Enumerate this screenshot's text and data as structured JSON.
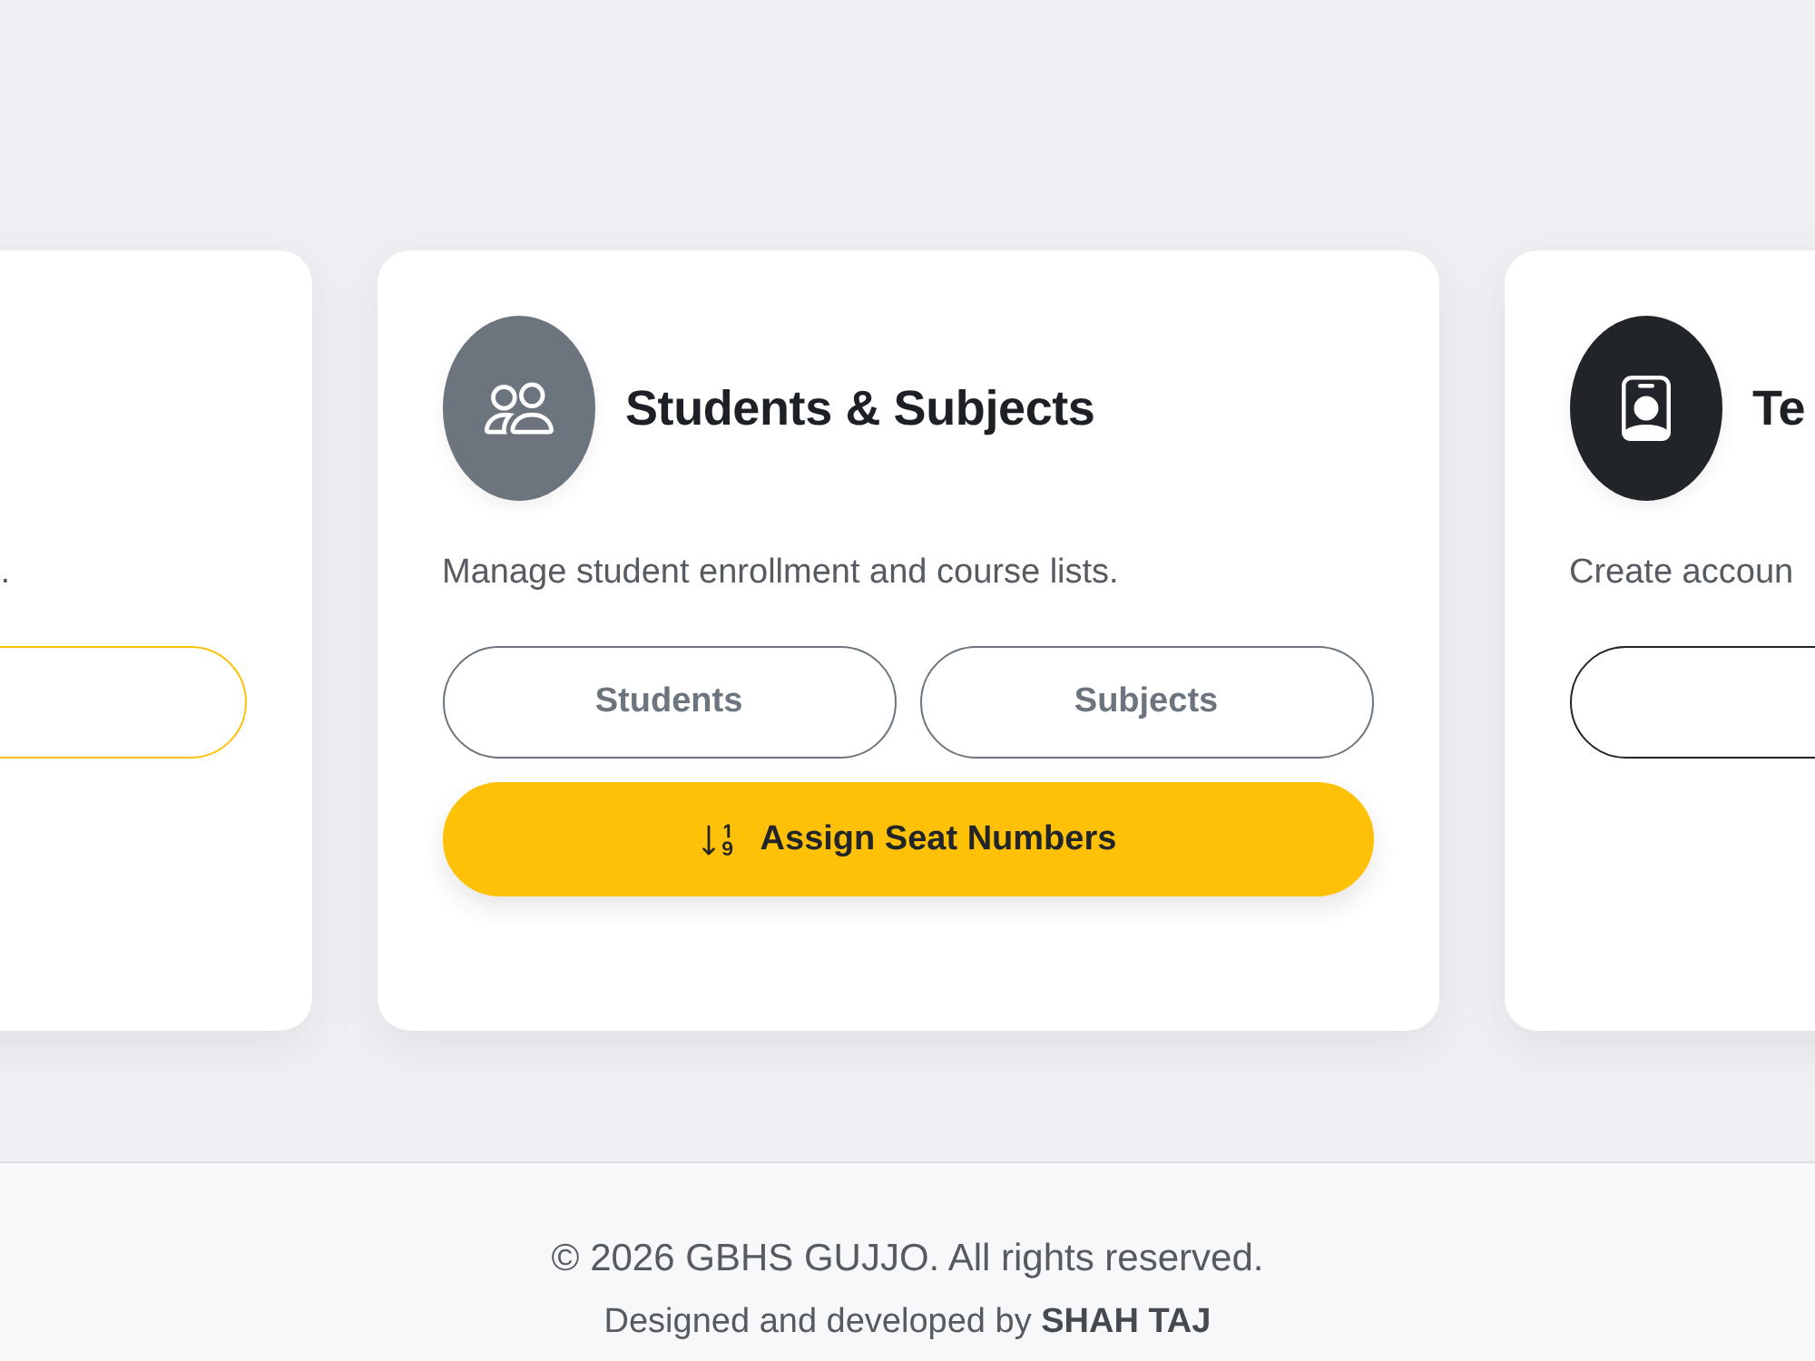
{
  "cards": [
    {
      "description": ".",
      "button_rows": [
        [
          {
            "kind": "outline",
            "color": "#ffc107"
          }
        ]
      ]
    },
    {
      "color": "#6c757d",
      "title": "Students & Subjects",
      "description": "Manage student enrollment and course lists.",
      "button_rows": [
        [
          {
            "kind": "outline",
            "color": "#6c757d",
            "label": "Students"
          },
          {
            "kind": "outline",
            "color": "#6c757d",
            "label": "Subjects"
          }
        ],
        [
          {
            "kind": "solid",
            "color": "#ffc107",
            "label": "Assign Seat Numbers"
          }
        ]
      ]
    },
    {
      "color": "#212529",
      "title": "Te",
      "description": "Create accoun",
      "button_rows": [
        [
          {
            "kind": "outline",
            "color": "#212529"
          }
        ]
      ]
    }
  ],
  "footer": {
    "copyright": "© 2026 GBHS GUJJO. All rights reserved.",
    "credits": "Designed and developed by **SHAH TAJ**"
  }
}
